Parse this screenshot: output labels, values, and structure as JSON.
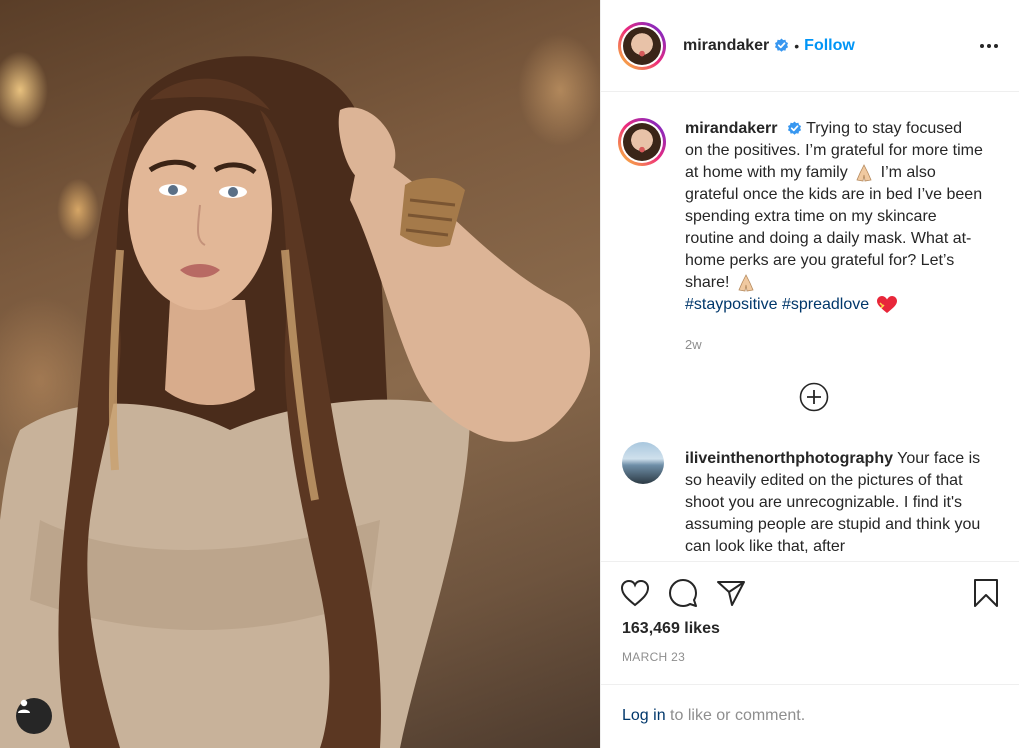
{
  "post": {
    "username": "mirandaker",
    "follow_label": "Follow",
    "caption": {
      "username": "mirandakerr",
      "text_1": "Trying to stay focused on the positives. I’m grateful for more time at home with my family",
      "text_2": "I’m also grateful once the kids are in bed I’ve been spending extra time on my skincare routine and doing a daily mask. What at-home perks are you grateful for? Let’s share!",
      "hashtag_1": "#staypositive",
      "hashtag_2": "#spreadlove",
      "time": "2w"
    },
    "comment": {
      "username": "iliveinthenorthphotography",
      "text": "Your face is so heavily edited on the pictures of that shoot you are unrecognizable. I find it's assuming people are stupid and think you can look like that, after"
    },
    "likes": "163,469 likes",
    "date": "MARCH 23",
    "login": {
      "link": "Log in",
      "rest": " to like or comment."
    }
  },
  "colors": {
    "follow_blue": "#0095f6",
    "link_dark_blue": "#00376b",
    "muted_gray": "#8e8e8e",
    "verified_blue": "#3897f0"
  }
}
